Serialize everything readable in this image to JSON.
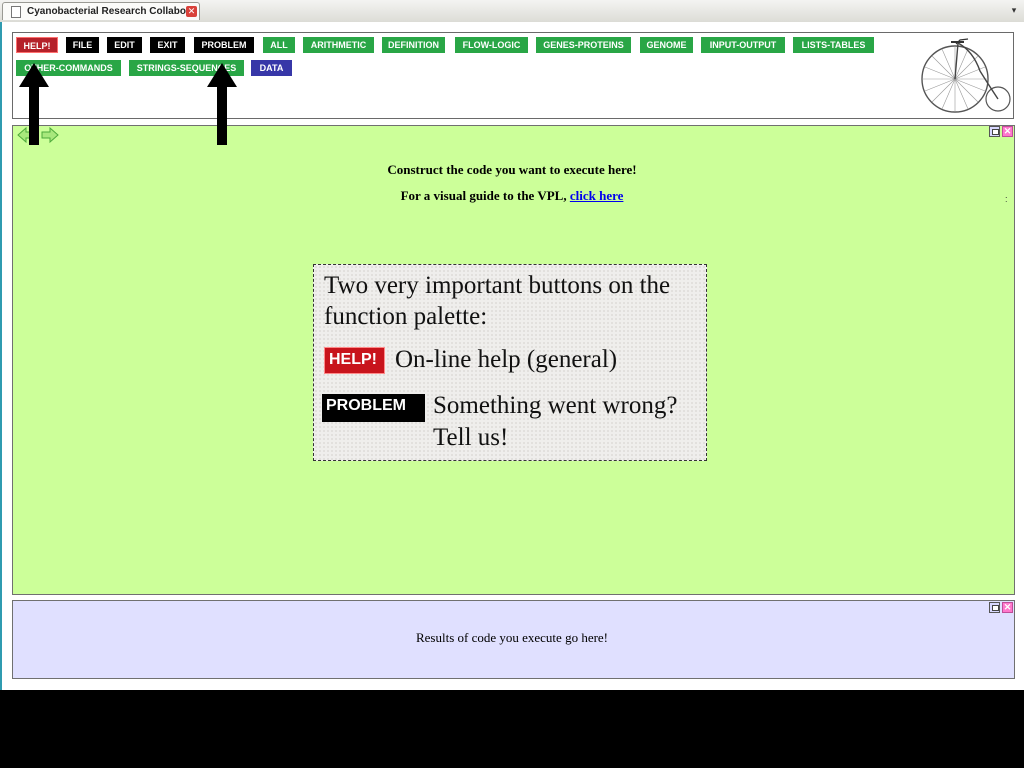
{
  "browser": {
    "tab_title": "Cyanobacterial Research Collabo...",
    "close_glyph": "✕",
    "scroll_glyph": "▾"
  },
  "palette": {
    "buttons": [
      {
        "label": "HELP!",
        "color": "red"
      },
      {
        "label": "FILE",
        "color": "black"
      },
      {
        "label": "EDIT",
        "color": "black"
      },
      {
        "label": "EXIT",
        "color": "black"
      },
      {
        "label": "PROBLEM",
        "color": "black"
      },
      {
        "label": "ALL",
        "color": "green"
      },
      {
        "label": "ARITHMETIC",
        "color": "green"
      },
      {
        "label": "DEFINITION",
        "color": "green"
      },
      {
        "label": "FLOW-LOGIC",
        "color": "green"
      },
      {
        "label": "GENES-PROTEINS",
        "color": "green"
      },
      {
        "label": "GENOME",
        "color": "green"
      },
      {
        "label": "INPUT-OUTPUT",
        "color": "green"
      },
      {
        "label": "LISTS-TABLES",
        "color": "green"
      },
      {
        "label": "OTHER-COMMANDS",
        "color": "green"
      },
      {
        "label": "STRINGS-SEQUENCES",
        "color": "green"
      },
      {
        "label": "DATA",
        "color": "blue"
      }
    ]
  },
  "editor": {
    "line1": "Construct the code you want to execute here!",
    "line2_prefix": "For a visual guide to the VPL, ",
    "link_text": "click here",
    "dot": ":"
  },
  "results": {
    "text": "Results of code you execute go here!"
  },
  "callout": {
    "title": "Two very important buttons on the function palette:",
    "help_button": "HELP!",
    "help_text": "On-line help (general)",
    "problem_button": "PROBLEM",
    "problem_text_1": "Something went wrong?",
    "problem_text_2": "Tell us!"
  },
  "colors": {
    "editor_bg": "#ccff99",
    "results_bg": "#e0e0ff",
    "help_red": "#b5212a",
    "category_green": "#29a646",
    "data_blue": "#3737a8"
  }
}
